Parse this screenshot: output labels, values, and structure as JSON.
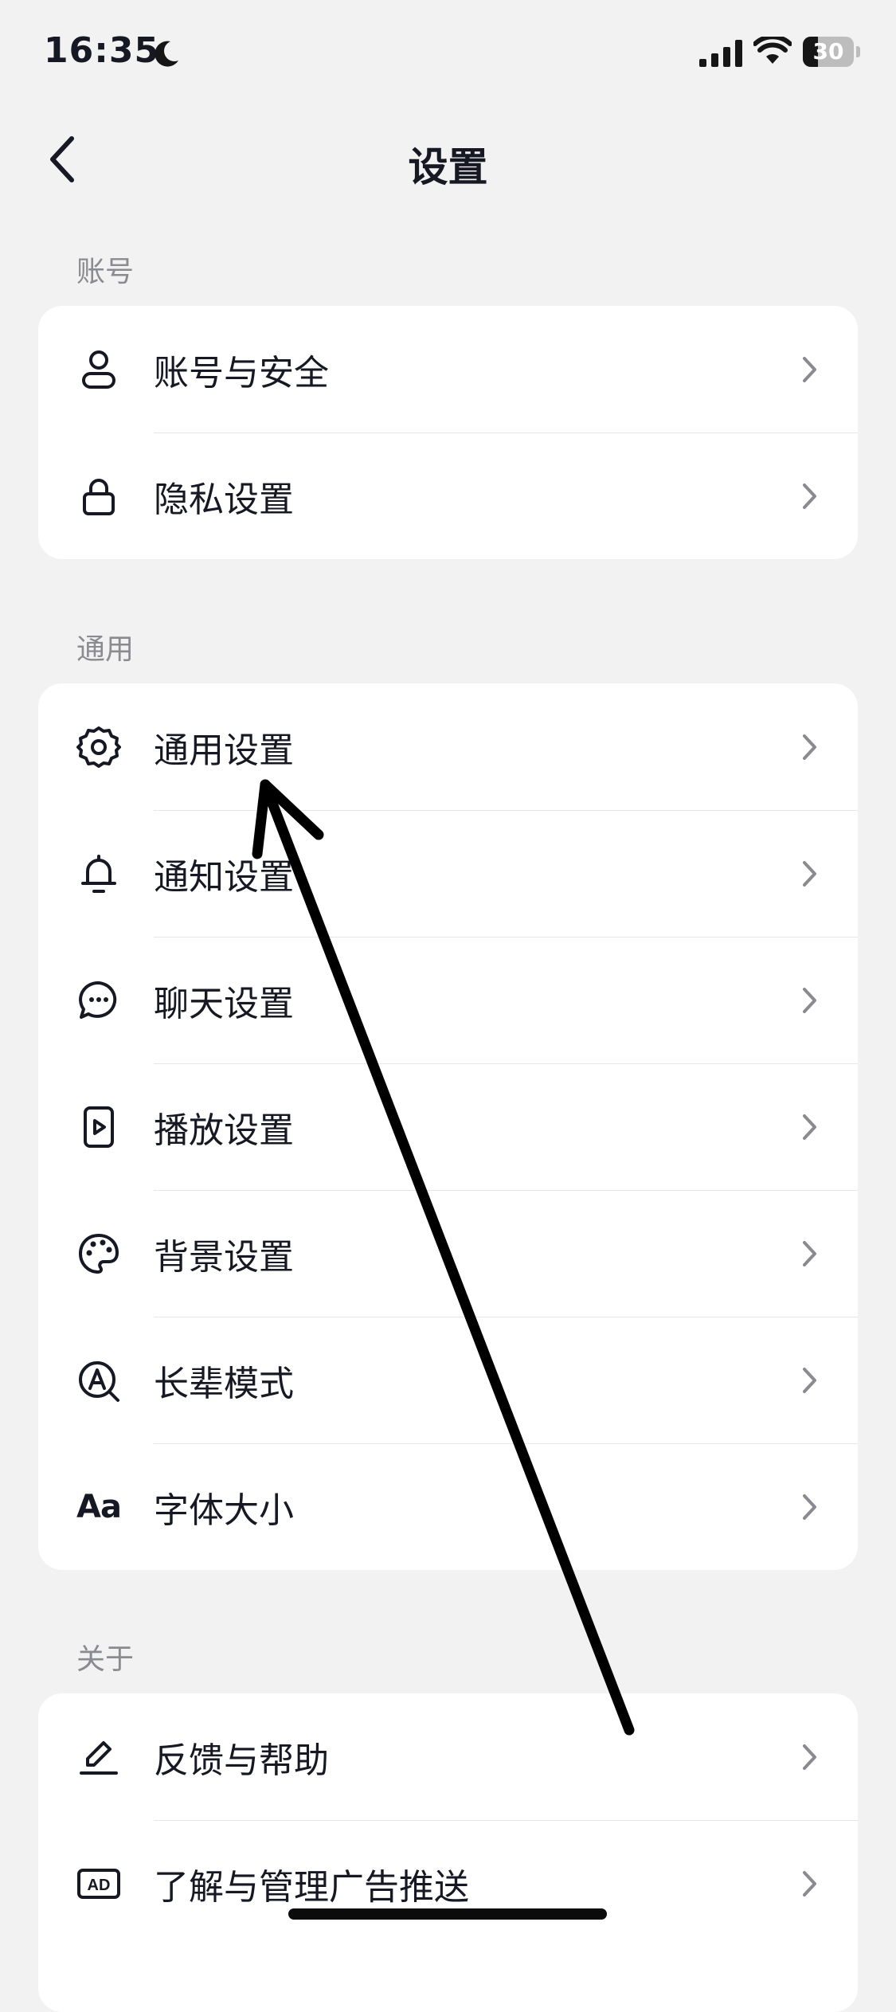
{
  "status_bar": {
    "time": "16:35",
    "battery_text": "30",
    "battery_level": 0.3
  },
  "nav": {
    "title": "设置"
  },
  "sections": [
    {
      "label": "账号",
      "items": [
        {
          "label": "账号与安全",
          "icon": "user-icon"
        },
        {
          "label": "隐私设置",
          "icon": "lock-icon"
        }
      ]
    },
    {
      "label": "通用",
      "items": [
        {
          "label": "通用设置",
          "icon": "gear-icon"
        },
        {
          "label": "通知设置",
          "icon": "bell-icon"
        },
        {
          "label": "聊天设置",
          "icon": "chat-bubble-icon"
        },
        {
          "label": "播放设置",
          "icon": "play-icon"
        },
        {
          "label": "背景设置",
          "icon": "palette-icon"
        },
        {
          "label": "长辈模式",
          "icon": "elder-mode-icon"
        },
        {
          "label": "字体大小",
          "icon": "font-size-icon",
          "icon_text": "Aa"
        }
      ]
    },
    {
      "label": "关于",
      "items": [
        {
          "label": "反馈与帮助",
          "icon": "edit-pen-icon"
        },
        {
          "label": "了解与管理广告推送",
          "icon": "ad-icon",
          "icon_text": "AD"
        }
      ]
    }
  ],
  "colors": {
    "background": "#f2f2f2",
    "card": "#ffffff",
    "text_primary": "#161823",
    "text_secondary": "#8a8b91",
    "annotation_arrow": "#000000"
  }
}
